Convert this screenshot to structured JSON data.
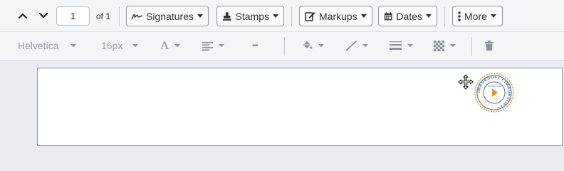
{
  "navigation": {
    "prev_icon": "chevron-up-icon",
    "next_icon": "chevron-down-icon",
    "page_value": "1",
    "of_label": "of 1"
  },
  "toolbar": {
    "signatures_label": "Signatures",
    "stamps_label": "Stamps",
    "markups_label": "Markups",
    "dates_label": "Dates",
    "more_label": "More"
  },
  "format_bar": {
    "font_family": "Helvetica",
    "font_size": "16px",
    "text_icon_glyph": "A",
    "more_glyph": "•••"
  },
  "stamp": {
    "ring_text": "IMAGESOFT • IMAGESOFT •",
    "inner_text": "ImageSoft",
    "accent": "#e8962e"
  },
  "colors": {
    "toolbar_bg": "#f4f5f6",
    "stamp_blue": "#4a78b5",
    "stamp_orange": "#e8962e"
  }
}
